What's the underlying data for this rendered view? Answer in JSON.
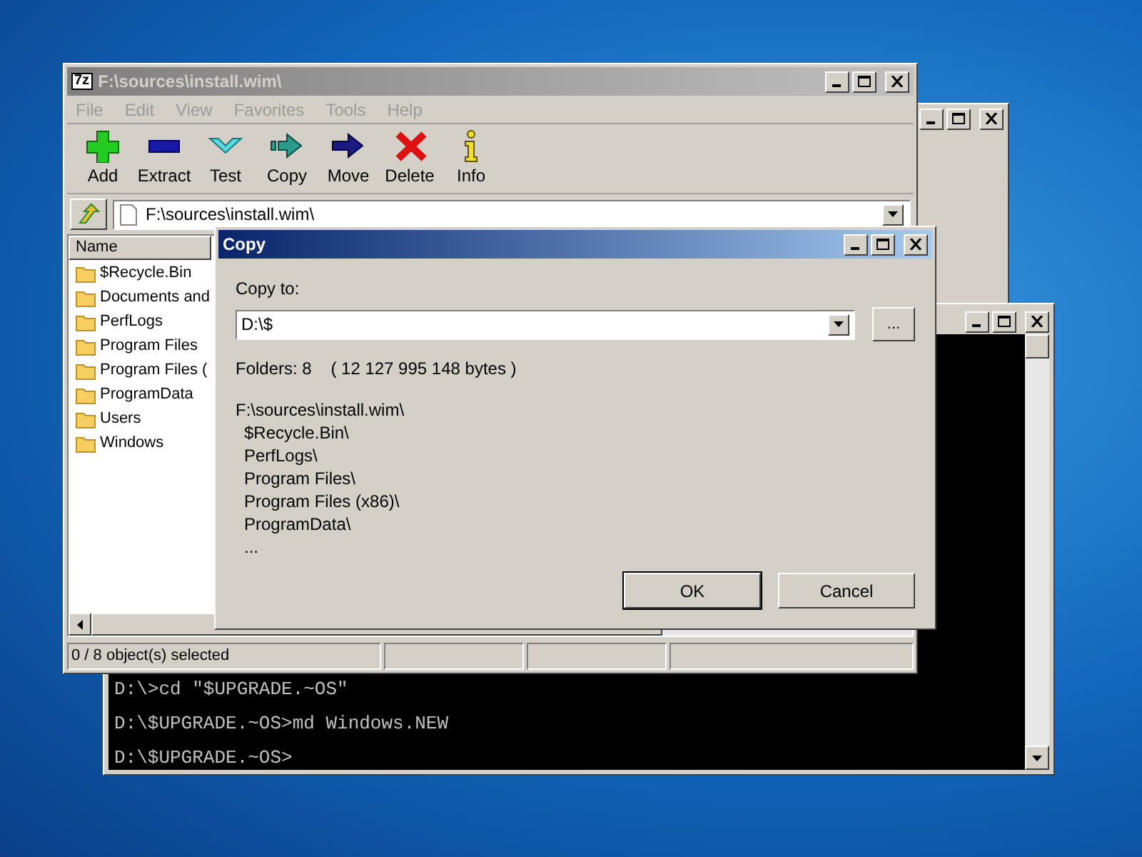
{
  "file_manager": {
    "app_icon": "7z",
    "title": "F:\\sources\\install.wim\\",
    "active": false,
    "menu": [
      "File",
      "Edit",
      "View",
      "Favorites",
      "Tools",
      "Help"
    ],
    "toolbar": [
      {
        "label": "Add",
        "kind": "add"
      },
      {
        "label": "Extract",
        "kind": "extract"
      },
      {
        "label": "Test",
        "kind": "test"
      },
      {
        "label": "Copy",
        "kind": "copy"
      },
      {
        "label": "Move",
        "kind": "move"
      },
      {
        "label": "Delete",
        "kind": "delete"
      },
      {
        "label": "Info",
        "kind": "info"
      }
    ],
    "address": "F:\\sources\\install.wim\\",
    "column_header": "Name",
    "items": [
      "$Recycle.Bin",
      "Documents and",
      "PerfLogs",
      "Program Files",
      "Program Files (",
      "ProgramData",
      "Users",
      "Windows"
    ],
    "status": "0 / 8 object(s) selected"
  },
  "dialog": {
    "title": "Copy",
    "active": true,
    "copy_to_label": "Copy to:",
    "copy_to_value": "D:\\$",
    "browse_button": "...",
    "summary": "Folders: 8    ( 12 127 995 148 bytes )",
    "paths": {
      "root": "F:\\sources\\install.wim\\",
      "children": [
        "$Recycle.Bin\\",
        "PerfLogs\\",
        "Program Files\\",
        "Program Files (x86)\\",
        "ProgramData\\",
        "..."
      ]
    },
    "ok_button": "OK",
    "cancel_button": "Cancel"
  },
  "console": {
    "lines": [
      "D:\\>cd \"$UPGRADE.~OS\"",
      "D:\\$UPGRADE.~OS>md Windows.NEW",
      "D:\\$UPGRADE.~OS>"
    ]
  }
}
